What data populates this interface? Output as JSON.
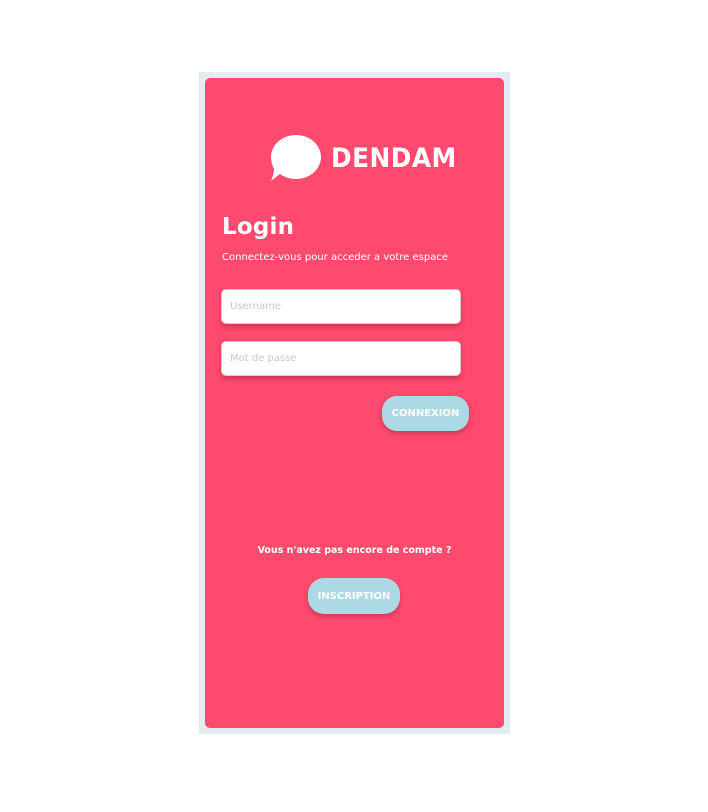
{
  "brand": {
    "name": "DENDAM",
    "logo_icon": "speech-bubble-icon"
  },
  "login": {
    "title": "Login",
    "subtitle": "Connectez-vous pour acceder a votre espace",
    "username_placeholder": "Username",
    "username_value": "",
    "password_placeholder": "Mot de passe",
    "password_value": "",
    "submit_label": "CONNEXION"
  },
  "signup": {
    "prompt": "Vous n'avez pas encore de compte ?",
    "button_label": "INSCRIPTION"
  },
  "colors": {
    "card_background": "#fd4a6e",
    "frame_background": "#e3ecf3",
    "button_background": "#add8e6",
    "text": "#ffffff"
  }
}
